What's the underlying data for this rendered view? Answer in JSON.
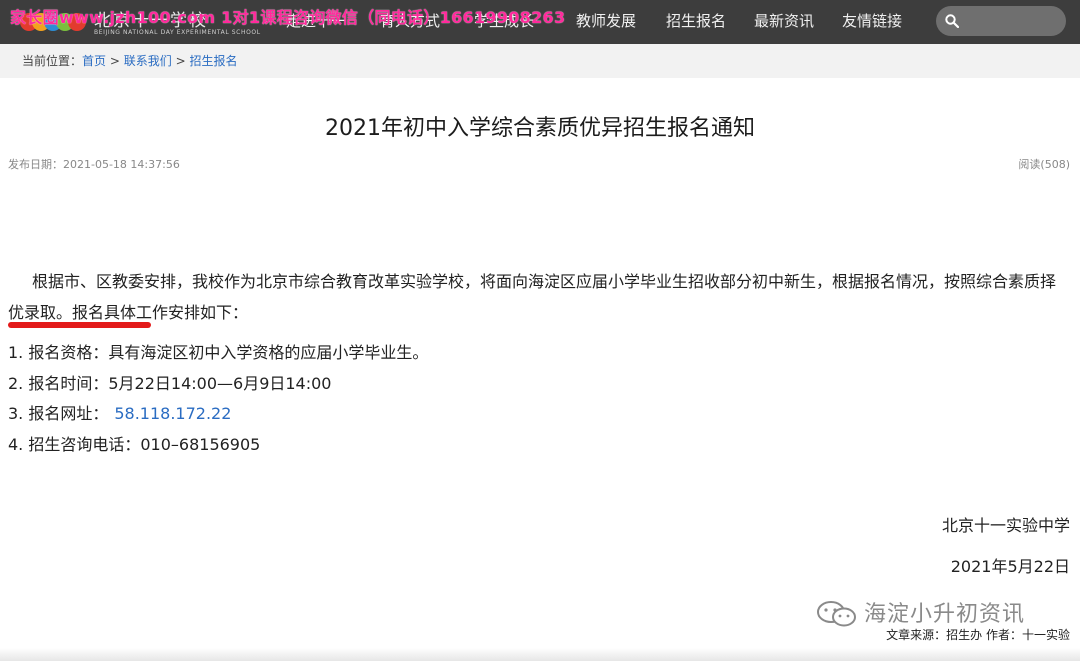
{
  "header": {
    "logo_cn": "北京十一学校",
    "logo_en": "BEIJING NATIONAL DAY EXPERIMENTAL SCHOOL",
    "nav": [
      {
        "label": "走进十一"
      },
      {
        "label": "育人方式"
      },
      {
        "label": "学生成长"
      },
      {
        "label": "教师发展"
      },
      {
        "label": "招生报名"
      },
      {
        "label": "最新资讯"
      },
      {
        "label": "友情链接"
      }
    ],
    "search_placeholder": "",
    "watermark": "家长圈www.jzh100.com  1对1课程咨询微信（同电话）16619908263"
  },
  "breadcrumb": {
    "prefix": "当前位置：",
    "items": [
      "首页",
      "联系我们",
      "招生报名"
    ],
    "separator": ">"
  },
  "article": {
    "title": "2021年初中入学综合素质优异招生报名通知",
    "date_label": "发布日期：2021-05-18 14:37:56",
    "read_count": "阅读(508)",
    "intro_a": "根据市、区教委安排，我校作为北京市综合教育改革实验学校，将面向海淀区应届小学毕业生招收部分初中新生，根据报名情况，按照",
    "intro_highlight": "综合素质择优录取",
    "intro_b": "。报名具体工作安排如下：",
    "items": [
      {
        "label": "1. 报名资格：",
        "value": "具有海淀区初中入学资格的应届小学毕业生。"
      },
      {
        "label": "2. 报名时间：",
        "value": "5月22日14:00—6月9日14:00"
      },
      {
        "label": "3. 报名网址：",
        "value": "58.118.172.22"
      },
      {
        "label": "4. 招生咨询电话：",
        "value": "010–68156905"
      }
    ],
    "signature_school": "北京十一实验中学",
    "signature_date": "2021年5月22日",
    "source": "文章来源：招生办  作者：十一实验"
  },
  "wechat_mark": "海淀小升初资讯",
  "colors": {
    "topbar": "#3d3d3d",
    "link": "#2a6cc2",
    "highlight_underline": "#e31a1a",
    "watermark": "#ff2a9c"
  }
}
